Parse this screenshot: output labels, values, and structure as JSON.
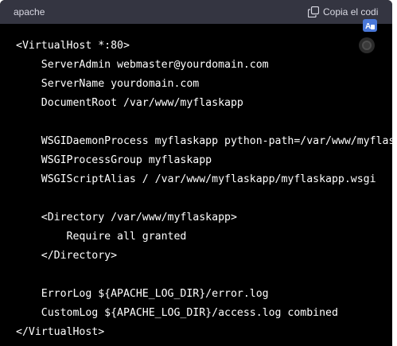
{
  "code_block": {
    "language": "apache",
    "copy_label": "Copia el codi",
    "icons": {
      "copy": "copy-icon",
      "translate": "translate-icon",
      "extension": "circle-icon"
    },
    "lines": [
      "<VirtualHost *:80>",
      "    ServerAdmin webmaster@yourdomain.com",
      "    ServerName yourdomain.com",
      "    DocumentRoot /var/www/myflaskapp",
      "",
      "    WSGIDaemonProcess myflaskapp python-path=/var/www/myflaskapp",
      "    WSGIProcessGroup myflaskapp",
      "    WSGIScriptAlias / /var/www/myflaskapp/myflaskapp.wsgi",
      "",
      "    <Directory /var/www/myflaskapp>",
      "        Require all granted",
      "    </Directory>",
      "",
      "    ErrorLog ${APACHE_LOG_DIR}/error.log",
      "    CustomLog ${APACHE_LOG_DIR}/access.log combined",
      "</VirtualHost>"
    ]
  },
  "colors": {
    "header_bg": "#343541",
    "code_bg": "#000000",
    "text": "#ffffff",
    "header_text": "#d9d9e3"
  }
}
